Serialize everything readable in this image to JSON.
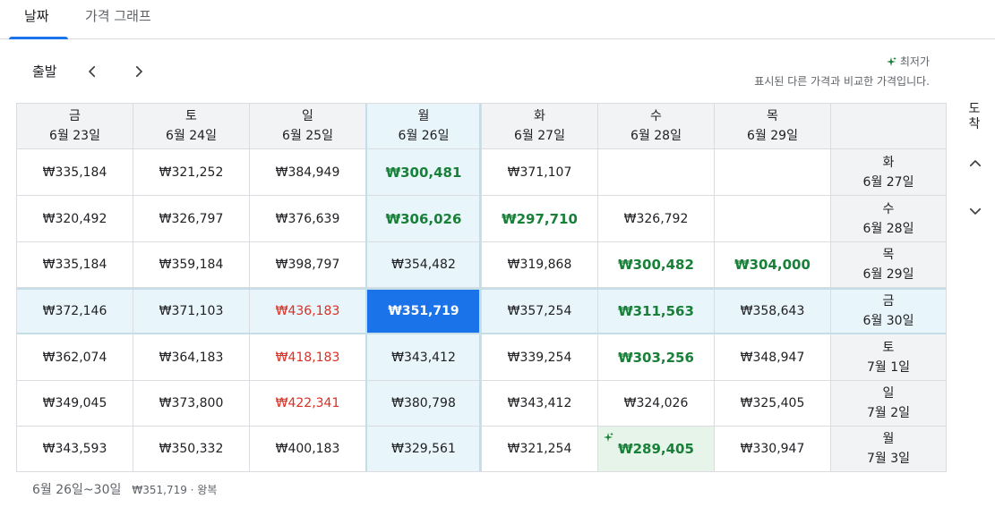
{
  "tabs": [
    {
      "label": "날짜",
      "active": true
    },
    {
      "label": "가격 그래프",
      "active": false
    }
  ],
  "departure_label": "출발",
  "arrival_label": "도착",
  "legend": {
    "title": "최저가",
    "subtitle": "표시된 다른 가격과 비교한 가격입니다."
  },
  "columns": [
    {
      "day": "금",
      "date": "6월 23일"
    },
    {
      "day": "토",
      "date": "6월 24일"
    },
    {
      "day": "일",
      "date": "6월 25일"
    },
    {
      "day": "월",
      "date": "6월 26일"
    },
    {
      "day": "화",
      "date": "6월 27일"
    },
    {
      "day": "수",
      "date": "6월 28일"
    },
    {
      "day": "목",
      "date": "6월 29일"
    }
  ],
  "rows": [
    {
      "day": "화",
      "date": "6월 27일",
      "prices": [
        "₩335,184",
        "₩321,252",
        "₩384,949",
        "₩300,481",
        "₩371,107",
        "",
        ""
      ]
    },
    {
      "day": "수",
      "date": "6월 28일",
      "prices": [
        "₩320,492",
        "₩326,797",
        "₩376,639",
        "₩306,026",
        "₩297,710",
        "₩326,792",
        ""
      ]
    },
    {
      "day": "목",
      "date": "6월 29일",
      "prices": [
        "₩335,184",
        "₩359,184",
        "₩398,797",
        "₩354,482",
        "₩319,868",
        "₩300,482",
        "₩304,000"
      ]
    },
    {
      "day": "금",
      "date": "6월 30일",
      "prices": [
        "₩372,146",
        "₩371,103",
        "₩436,183",
        "₩351,719",
        "₩357,254",
        "₩311,563",
        "₩358,643"
      ]
    },
    {
      "day": "토",
      "date": "7월 1일",
      "prices": [
        "₩362,074",
        "₩364,183",
        "₩418,183",
        "₩343,412",
        "₩339,254",
        "₩303,256",
        "₩348,947"
      ]
    },
    {
      "day": "일",
      "date": "7월 2일",
      "prices": [
        "₩349,045",
        "₩373,800",
        "₩422,341",
        "₩380,798",
        "₩343,412",
        "₩324,026",
        "₩325,405"
      ]
    },
    {
      "day": "월",
      "date": "7월 3일",
      "prices": [
        "₩343,593",
        "₩350,332",
        "₩400,183",
        "₩329,561",
        "₩321,254",
        "₩289,405",
        "₩330,947"
      ]
    }
  ],
  "price_levels": [
    [
      "normal",
      "normal",
      "normal",
      "low",
      "normal",
      "empty",
      "empty"
    ],
    [
      "normal",
      "normal",
      "normal",
      "low",
      "low",
      "normal",
      "empty"
    ],
    [
      "normal",
      "normal",
      "normal",
      "normal",
      "normal",
      "low",
      "low"
    ],
    [
      "normal",
      "normal",
      "high",
      "selected",
      "normal",
      "low",
      "normal"
    ],
    [
      "normal",
      "normal",
      "high",
      "normal",
      "normal",
      "low",
      "normal"
    ],
    [
      "normal",
      "normal",
      "high",
      "normal",
      "normal",
      "normal",
      "normal"
    ],
    [
      "normal",
      "normal",
      "normal",
      "normal",
      "normal",
      "best",
      "normal"
    ]
  ],
  "selected": {
    "column": 3,
    "row": 3
  },
  "footer": {
    "dates": "6월 26일~30일",
    "price": "₩351,719 · 왕복"
  },
  "colors": {
    "accent": "#1a73e8",
    "low": "#188038",
    "high": "#d93025",
    "highlight": "#e8f5fa",
    "best_bg": "#e6f4ea"
  }
}
